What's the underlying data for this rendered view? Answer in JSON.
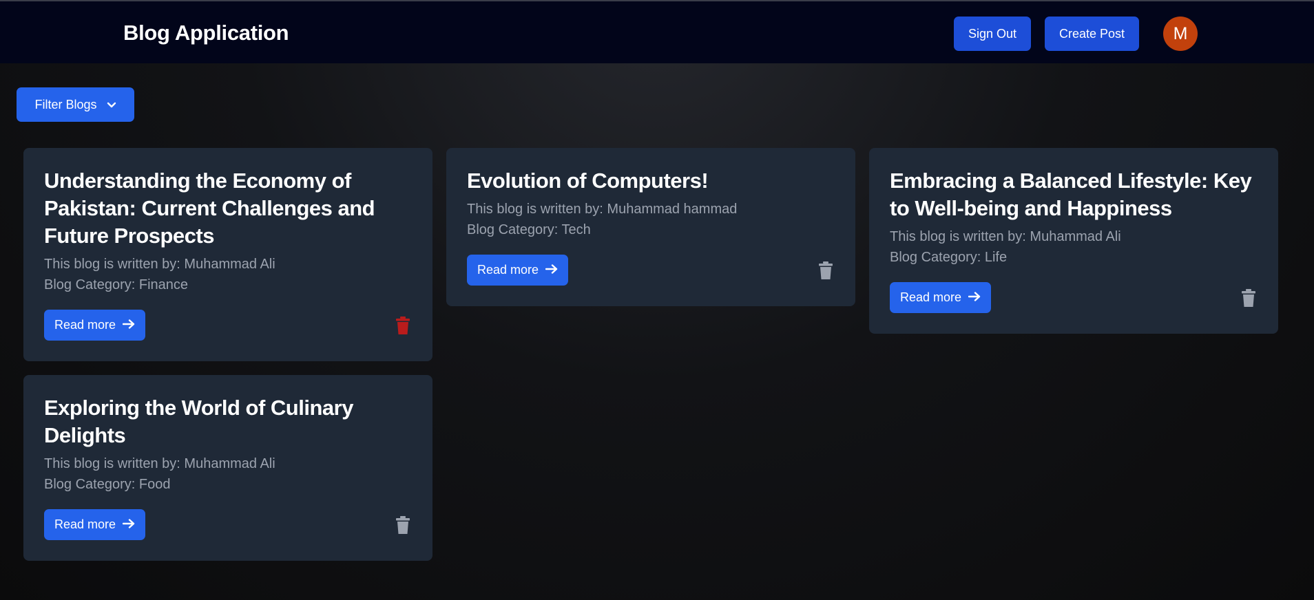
{
  "header": {
    "title": "Blog Application",
    "sign_out_label": "Sign Out",
    "create_post_label": "Create Post",
    "avatar_initial": "M"
  },
  "filter": {
    "label": "Filter Blogs",
    "icon": "chevron-down-icon"
  },
  "posts": [
    {
      "title": "Understanding the Economy of Pakistan: Current Challenges and Future Prospects",
      "author_line": "This blog is written by: Muhammad Ali",
      "category_line": "Blog Category: Finance",
      "read_more_label": "Read more",
      "delete_icon_color": "#b91c1c"
    },
    {
      "title": "Evolution of Computers!",
      "author_line": "This blog is written by: Muhammad hammad",
      "category_line": "Blog Category: Tech",
      "read_more_label": "Read more",
      "delete_icon_color": "#9ca3af"
    },
    {
      "title": "Embracing a Balanced Lifestyle: Key to Well-being and Happiness",
      "author_line": "This blog is written by: Muhammad Ali",
      "category_line": "Blog Category: Life",
      "read_more_label": "Read more",
      "delete_icon_color": "#9ca3af"
    },
    {
      "title": "Exploring the World of Culinary Delights",
      "author_line": "This blog is written by: Muhammad Ali",
      "category_line": "Blog Category: Food",
      "read_more_label": "Read more",
      "delete_icon_color": "#9ca3af"
    }
  ],
  "colors": {
    "header_bg": "#02051a",
    "primary_button": "#2563eb",
    "nav_button": "#1d4ed8",
    "card_bg": "#1f2937",
    "avatar_bg": "#c2410c",
    "muted_text": "#9ca3af"
  }
}
